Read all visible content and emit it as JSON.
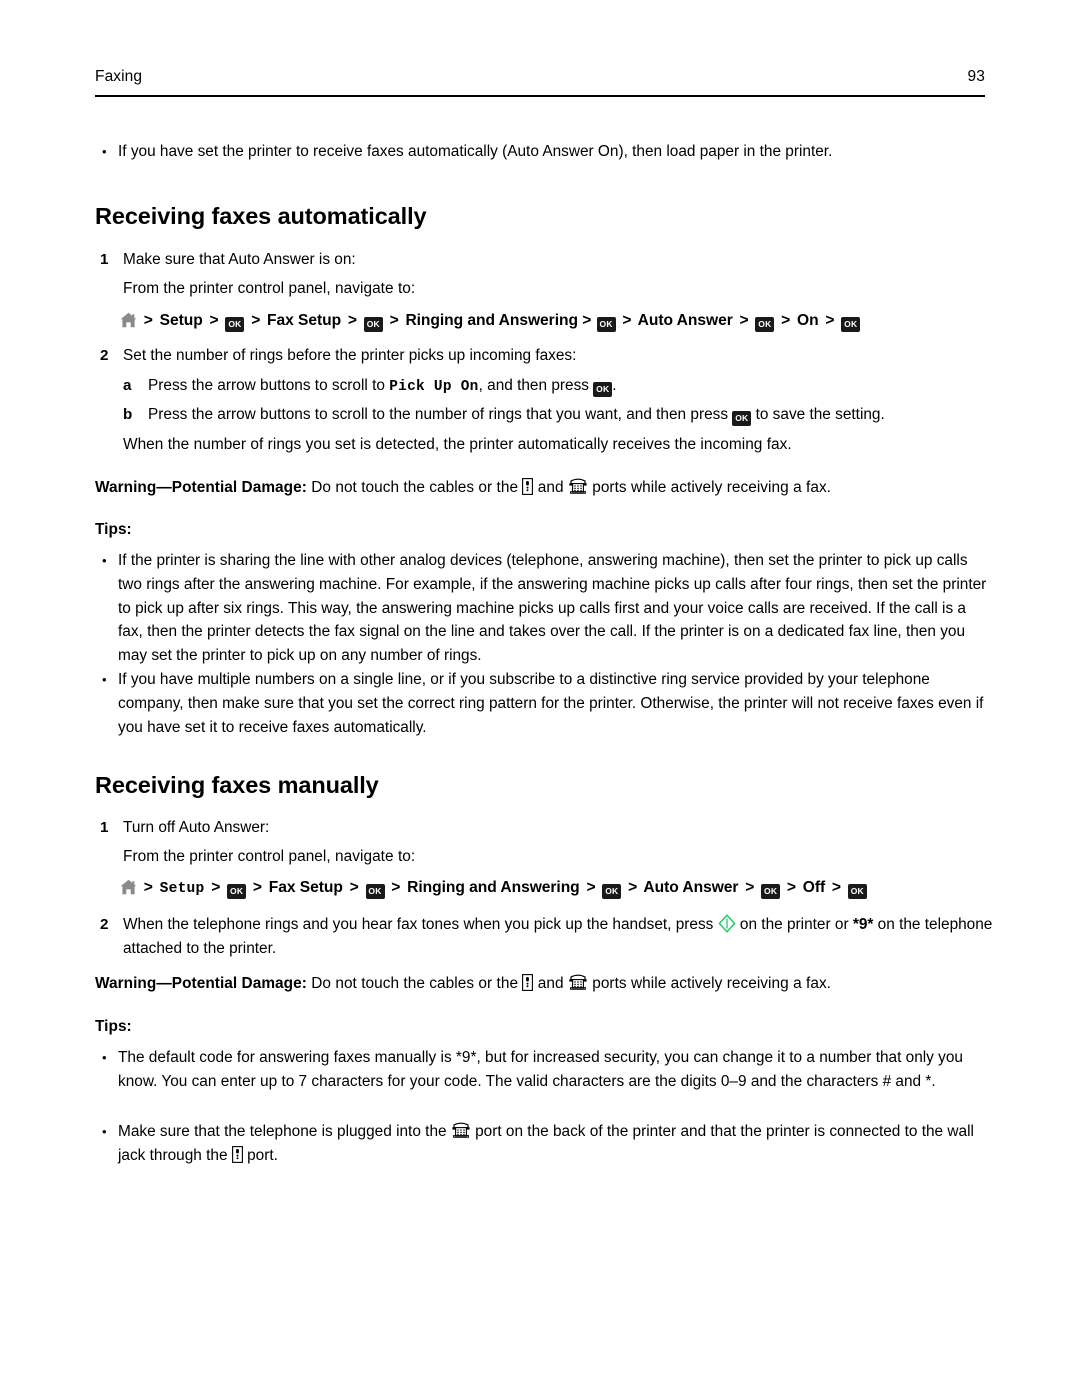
{
  "header": {
    "chapter": "Faxing",
    "page_number": "93"
  },
  "intro_bullet": {
    "text": "If you have set the printer to receive faxes automatically (Auto Answer On), then load paper in the printer."
  },
  "section_auto": {
    "heading": "Receiving faxes automatically",
    "step1": {
      "number": "1",
      "text": "Make sure that Auto Answer is on:",
      "navigate_intro": "From the printer control panel, navigate to:",
      "path": {
        "home_icon": "home-icon",
        "item1": "Setup",
        "ok1": "OK",
        "item2": "Fax Setup",
        "ok2": "OK",
        "item3": "Ringing and Answering",
        "ok3": "OK",
        "item4": "Auto Answer",
        "ok4": "OK",
        "item5": "On",
        "ok5": "OK",
        "separator": ">"
      }
    },
    "step2": {
      "number": "2",
      "text": "Set the number of rings before the printer picks up incoming faxes:",
      "sub_a": {
        "letter": "a",
        "text_before": "Press the arrow buttons to scroll to ",
        "mono_value": "Pick Up On",
        "text_middle": ", and then press ",
        "ok_label": "OK",
        "text_after": "."
      },
      "sub_b": {
        "letter": "b",
        "text_before": "Press the arrow buttons to scroll to the number of rings that you want, and then press ",
        "ok_label": "OK",
        "text_after": " to save the setting."
      },
      "closing": "When the number of rings you set is detected, the printer automatically receives the incoming fax."
    },
    "warning": {
      "label": "Warning—Potential Damage:",
      "text_before": " Do not touch the cables or the ",
      "line_icon": "line-port-icon",
      "text_middle": " and ",
      "ext_icon": "ext-port-icon",
      "text_after": " ports while actively receiving a fax."
    },
    "tips_label": "Tips:",
    "tips": [
      "If the printer is sharing the line with other analog devices (telephone, answering machine), then set the printer to pick up calls two rings after the answering machine. For example, if the answering machine picks up calls after four rings, then set the printer to pick up after six rings. This way, the answering machine picks up calls first and your voice calls are received. If the call is a fax, then the printer detects the fax signal on the line and takes over the call. If the printer is on a dedicated fax line, then you may set the printer to pick up on any number of rings.",
      "If you have multiple numbers on a single line, or if you subscribe to a distinctive ring service provided by your telephone company, then make sure that you set the correct ring pattern for the printer. Otherwise, the printer will not receive faxes even if you have set it to receive faxes automatically."
    ]
  },
  "section_manual": {
    "heading": "Receiving faxes manually",
    "step1": {
      "number": "1",
      "text": "Turn off Auto Answer:",
      "navigate_intro": "From the printer control panel, navigate to:",
      "path": {
        "home_icon": "home-icon",
        "item1": "Setup",
        "ok1": "OK",
        "item2": "Fax Setup",
        "ok2": "OK",
        "item3": "Ringing and Answering",
        "ok3": "OK",
        "item4": "Auto Answer",
        "ok4": "OK",
        "item5": "Off",
        "ok5": "OK",
        "separator": ">"
      }
    },
    "step2": {
      "number": "2",
      "text_before": "When the telephone rings and you hear fax tones when you pick up the handset, press ",
      "start_icon": "start-button-icon",
      "text_middle": " on the printer or ",
      "code": "*9*",
      "text_after": " on the telephone attached to the printer."
    },
    "warning": {
      "label": "Warning—Potential Damage:",
      "text_before": " Do not touch the cables or the ",
      "line_icon": "line-port-icon",
      "text_middle": " and ",
      "ext_icon": "ext-port-icon",
      "text_after": " ports while actively receiving a fax."
    },
    "tips_label": "Tips:",
    "tip1": "The default code for answering faxes manually is *9*, but for increased security, you can change it to a number that only you know. You can enter up to 7 characters for your code. The valid characters are the digits 0–9 and the characters # and *.",
    "tip2": {
      "text_before": "Make sure that the telephone is plugged into the ",
      "ext_icon": "ext-port-icon",
      "text_middle": " port on the back of the printer and that the printer is connected to the wall jack through the ",
      "line_icon": "line-port-icon",
      "text_after": " port."
    }
  },
  "colors": {
    "start_icon_green": "#22cc66",
    "ok_button_bg": "#1a1a1a",
    "home_icon_gray": "#8a8a8a",
    "text": "#000000"
  },
  "bullet_glyph": "•"
}
